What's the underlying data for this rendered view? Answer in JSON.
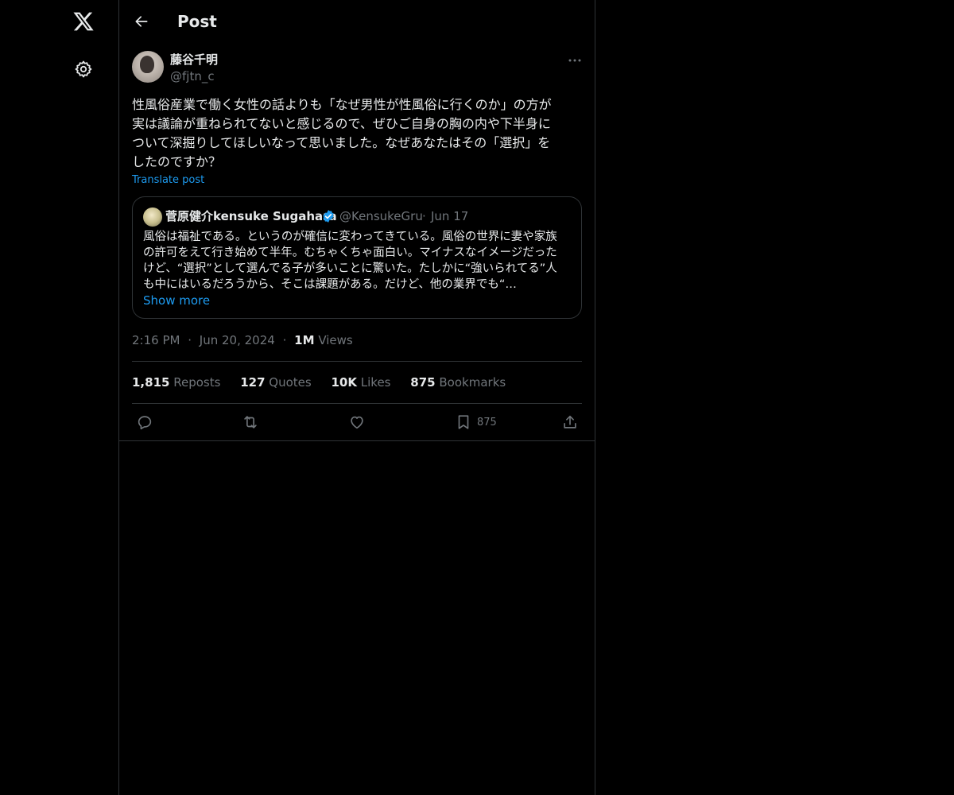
{
  "nav": {
    "logo": "x-logo-icon",
    "settings": "gear-icon"
  },
  "header": {
    "title": "Post",
    "back": "arrow-left-icon"
  },
  "post": {
    "author_name": "藤谷千明",
    "author_handle": "@fjtn_c",
    "text": "性風俗産業で働く女性の話よりも「なぜ男性が性風俗に行くのか」の方が\n実は議論が重ねられてないと感じるので、ぜひご自身の胸の内や下半身に\nついて深掘りしてほしいなって思いました。なぜあなたはその「選択」を\nしたのですか？",
    "translate": "Translate post",
    "time": "2:16 PM",
    "date": "Jun 20, 2024",
    "views_count": "1M",
    "views_label": "Views"
  },
  "quote": {
    "name": "菅原健介kensuke Sugahara",
    "handle": "@KensukeGru",
    "separator": "·",
    "date": "Jun 17",
    "text": "風俗は福祉である。というのが確信に変わってきている。風俗の世界に妻や家族\nの許可をえて行き始めて半年。むちゃくちゃ面白い。マイナスなイメージだった\nけど、“選択”として選んでる子が多いことに驚いた。たしかに“強いられてる”人\nも中にはいるだろうから、そこは課題がある。だけど、他の業界でも“…",
    "show_more": "Show more"
  },
  "stats": {
    "reposts_count": "1,815",
    "reposts_label": "Reposts",
    "quotes_count": "127",
    "quotes_label": "Quotes",
    "likes_count": "10K",
    "likes_label": "Likes",
    "bookmarks_count": "875",
    "bookmarks_label": "Bookmarks"
  },
  "actions": {
    "bookmark_count": "875"
  },
  "colors": {
    "background": "#000000",
    "text": "#e7e9ea",
    "muted": "#71767b",
    "accent": "#1d9bf0",
    "border": "#2f3336"
  }
}
